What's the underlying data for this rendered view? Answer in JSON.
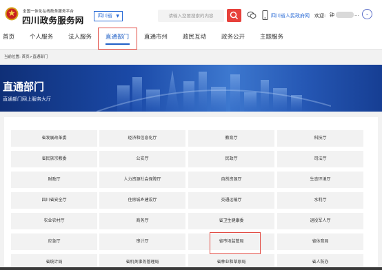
{
  "header": {
    "logo_sub": "全国一体化在线政务服务平台",
    "logo_main": "四川政务服务网",
    "region": "四川省",
    "search_placeholder": "请输入您要搜索的内容",
    "gov_link": "四川省人民政府网",
    "welcome": "欢迎:",
    "user_name": "钟",
    "user_ellipsis": "...",
    "colors": {
      "brand_blue": "#1f5fc6",
      "search_red": "#e7413b"
    },
    "icons": [
      "emblem-icon",
      "search-icon",
      "wechat-icon",
      "mobile-icon",
      "chevron-down-icon"
    ]
  },
  "nav": {
    "items": [
      "首页",
      "个人服务",
      "法人服务",
      "直通部门",
      "直通市州",
      "政民互动",
      "政务公开",
      "主题服务"
    ],
    "active": "直通部门"
  },
  "breadcrumb": "当前位置: 首页>直通部门",
  "banner": {
    "title": "直通部门",
    "subtitle": "直通部门网上服务大厅"
  },
  "departments": [
    [
      "省发展改革委",
      "经济和信息化厅",
      "教育厅",
      "科技厅"
    ],
    [
      "省民族宗教委",
      "公安厅",
      "民政厅",
      "司法厅"
    ],
    [
      "财政厅",
      "人力资源社会保障厅",
      "自然资源厅",
      "生态环境厅"
    ],
    [
      "四川省安全厅",
      "住房城乡建设厅",
      "交通运输厅",
      "水利厅"
    ],
    [
      "农业农村厅",
      "商务厅",
      "省卫生健康委",
      "退役军人厅"
    ],
    [
      "应急厅",
      "审计厅",
      "省市场监管局",
      "省体育局"
    ],
    [
      "省统计局",
      "省机关事务管理局",
      "省林业和草原局",
      "省人防办"
    ]
  ],
  "highlighted_department": "省市场监管局"
}
